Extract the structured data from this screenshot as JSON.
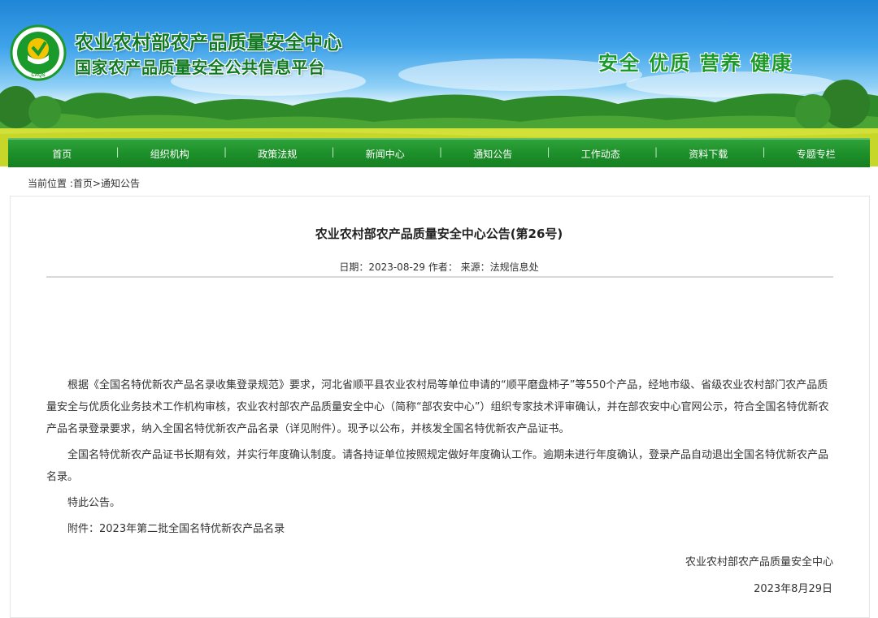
{
  "header": {
    "logo_text": "CAQS",
    "title_line1": "农业农村部农产品质量安全中心",
    "title_line2": "国家农产品质量安全公共信息平台",
    "slogan": "安全 优质 营养 健康"
  },
  "nav": {
    "items": [
      "首页",
      "组织机构",
      "政策法规",
      "新闻中心",
      "通知公告",
      "工作动态",
      "资料下载",
      "专题专栏"
    ]
  },
  "breadcrumb": {
    "prefix": "当前位置 :",
    "home": "首页",
    "separator": ">",
    "current": "通知公告"
  },
  "article": {
    "title": "农业农村部农产品质量安全中心公告(第26号)",
    "meta": "日期：2023-08-29 作者： 来源：法规信息处",
    "paragraphs": [
      "根据《全国名特优新农产品名录收集登录规范》要求，河北省顺平县农业农村局等单位申请的“顺平磨盘柿子”等550个产品，经地市级、省级农业农村部门农产品质量安全与优质化业务技术工作机构审核，农业农村部农产品质量安全中心（简称“部农安中心”）组织专家技术评审确认，并在部农安中心官网公示，符合全国名特优新农产品名录登录要求，纳入全国名特优新农产品名录（详见附件）。现予以公布，并核发全国名特优新农产品证书。",
      "全国名特优新农产品证书长期有效，并实行年度确认制度。请各持证单位按照规定做好年度确认工作。逾期未进行年度确认，登录产品自动退出全国名特优新农产品名录。",
      "特此公告。",
      "附件：2023年第二批全国名特优新农产品名录"
    ],
    "signature": "农业农村部农产品质量安全中心",
    "date": "2023年8月29日"
  },
  "colors": {
    "nav_green": "#1c8e29",
    "title_green": "#0f7a21",
    "slogan_green": "#1a9a2a"
  }
}
